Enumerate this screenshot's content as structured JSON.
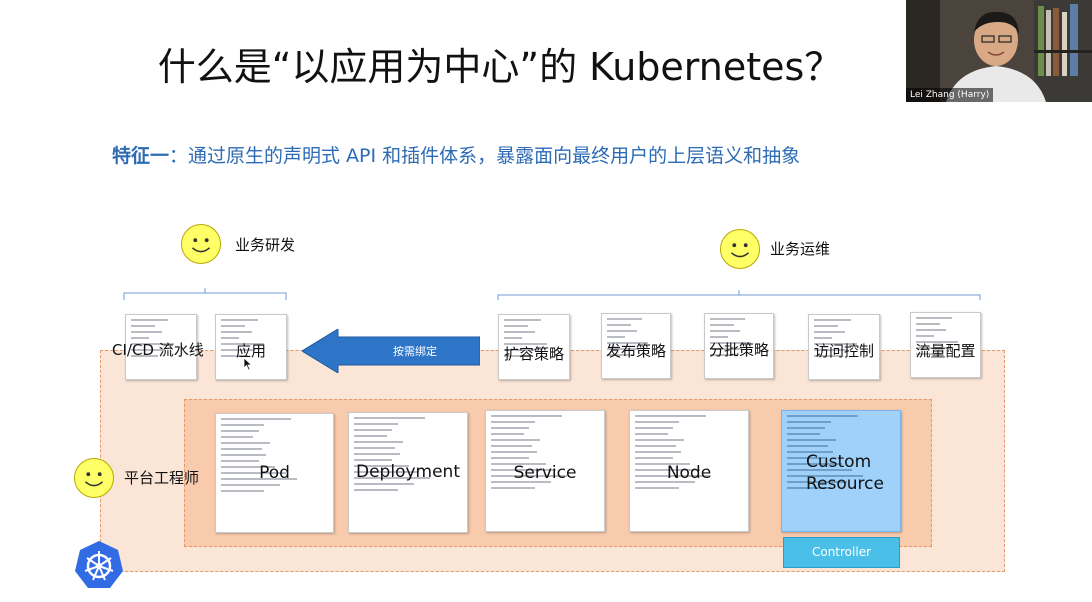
{
  "title": "什么是“以应用为中心”的 Kubernetes？",
  "subtitle": {
    "lead": "特征一",
    "rest": "：通过原生的声明式 API 和插件体系，暴露面向最终用户的上层语义和抽象"
  },
  "roles": {
    "dev": "业务研发",
    "ops": "业务运维",
    "platform": "平台工程师"
  },
  "dev_cards": [
    "CI/CD 流水线",
    "应用"
  ],
  "arrow_label": "按需绑定",
  "ops_cards": [
    "扩容策略",
    "发布策略",
    "分批策略",
    "访问控制",
    "流量配置"
  ],
  "platform_cards": [
    "Pod",
    "Deployment",
    "Service",
    "Node",
    "Custom Resource"
  ],
  "controller_label": "Controller",
  "video": {
    "name": "Lei Zhang (Harry)"
  },
  "colors": {
    "subtitle": "#2d6bb5",
    "orange_outer": "#fbe5d6",
    "orange_inner": "#f8cbad",
    "custom_resource": "#9fd1fb",
    "controller": "#4ac0e8",
    "arrow": "#2e75c8",
    "smiley": "#ffff66",
    "kubernetes_logo": "#326ce5"
  },
  "icons": [
    "smiley-icon",
    "kubernetes-logo-icon",
    "mouse-cursor-icon"
  ]
}
